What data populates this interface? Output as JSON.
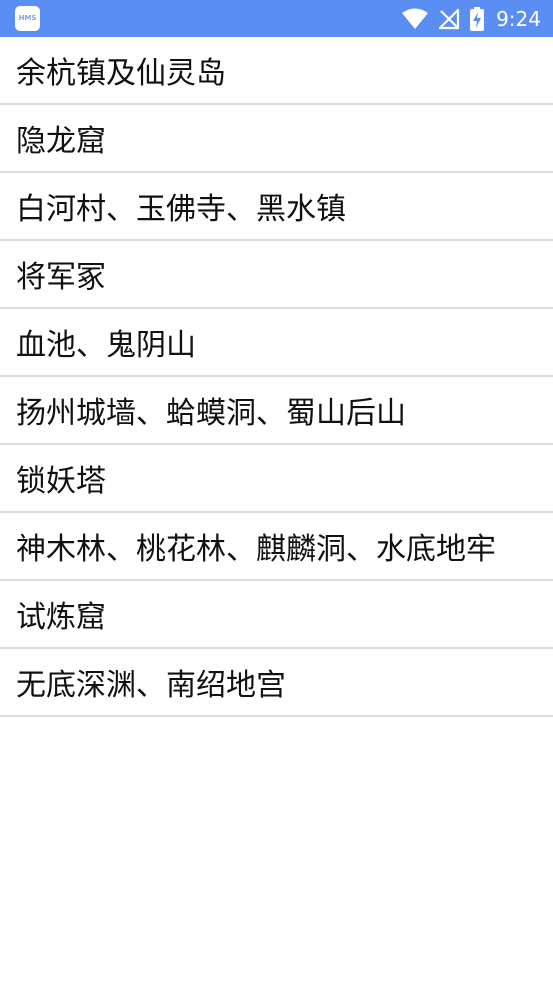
{
  "status_bar": {
    "app_icon_text": "HMS",
    "time": "9:24",
    "icons": [
      "wifi-icon",
      "no-signal-icon",
      "battery-charging-icon"
    ]
  },
  "list": {
    "items": [
      {
        "label": "余杭镇及仙灵岛"
      },
      {
        "label": "隐龙窟"
      },
      {
        "label": "白河村、玉佛寺、黑水镇"
      },
      {
        "label": "将军冢"
      },
      {
        "label": "血池、鬼阴山"
      },
      {
        "label": "扬州城墙、蛤蟆洞、蜀山后山"
      },
      {
        "label": "锁妖塔"
      },
      {
        "label": "神木林、桃花林、麒麟洞、水底地牢"
      },
      {
        "label": "试炼窟"
      },
      {
        "label": "无底深渊、南绍地宫"
      }
    ]
  },
  "colors": {
    "status_bar": "#5b8ef2",
    "divider": "#dcdcdc",
    "text": "#111111"
  }
}
